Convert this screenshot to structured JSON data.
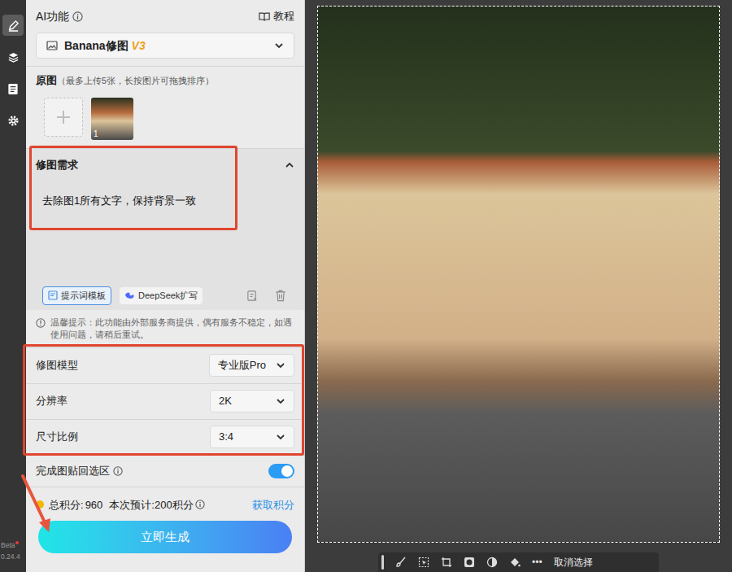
{
  "rail": {
    "items": [
      {
        "kind": "edit",
        "selected": true
      },
      {
        "kind": "layers",
        "selected": false
      },
      {
        "kind": "save",
        "selected": false
      },
      {
        "kind": "settings",
        "selected": false
      }
    ],
    "badge": "Beta",
    "version": "0.24.4"
  },
  "panel": {
    "title": "AI功能",
    "tutorial": "教程",
    "feature": {
      "name": "Banana修图",
      "version": "V3"
    },
    "source": {
      "title": "原图",
      "hint": "（最多上传5张，长按图片可拖拽排序）",
      "images": [
        {
          "index": "1"
        }
      ]
    },
    "prompt": {
      "title": "修图需求",
      "expanded": true,
      "text": "去除图1所有文字，保持背景一致",
      "template": "提示词模板",
      "expand": "DeepSeek扩写"
    },
    "notice": "温馨提示：此功能由外部服务商提供，偶有服务不稳定，如遇使用问题，请稍后重试。",
    "settings": [
      {
        "label": "修图模型",
        "value": "专业版Pro"
      },
      {
        "label": "分辨率",
        "value": "2K"
      },
      {
        "label": "尺寸比例",
        "value": "3:4"
      }
    ],
    "paste_back": {
      "label": "完成图贴回选区",
      "on": true
    },
    "credits": {
      "total_label": "总积分:",
      "total": "960",
      "estimate": "本次预计:200积分",
      "get": "获取积分"
    },
    "generate": "立即生成"
  },
  "canvas": {
    "toolbar": {
      "tools": [
        {
          "kind": "brush"
        },
        {
          "kind": "select"
        },
        {
          "kind": "crop"
        },
        {
          "kind": "circle"
        },
        {
          "kind": "contrast"
        },
        {
          "kind": "fill"
        }
      ],
      "more": "•••",
      "deselect": "取消选择"
    }
  }
}
